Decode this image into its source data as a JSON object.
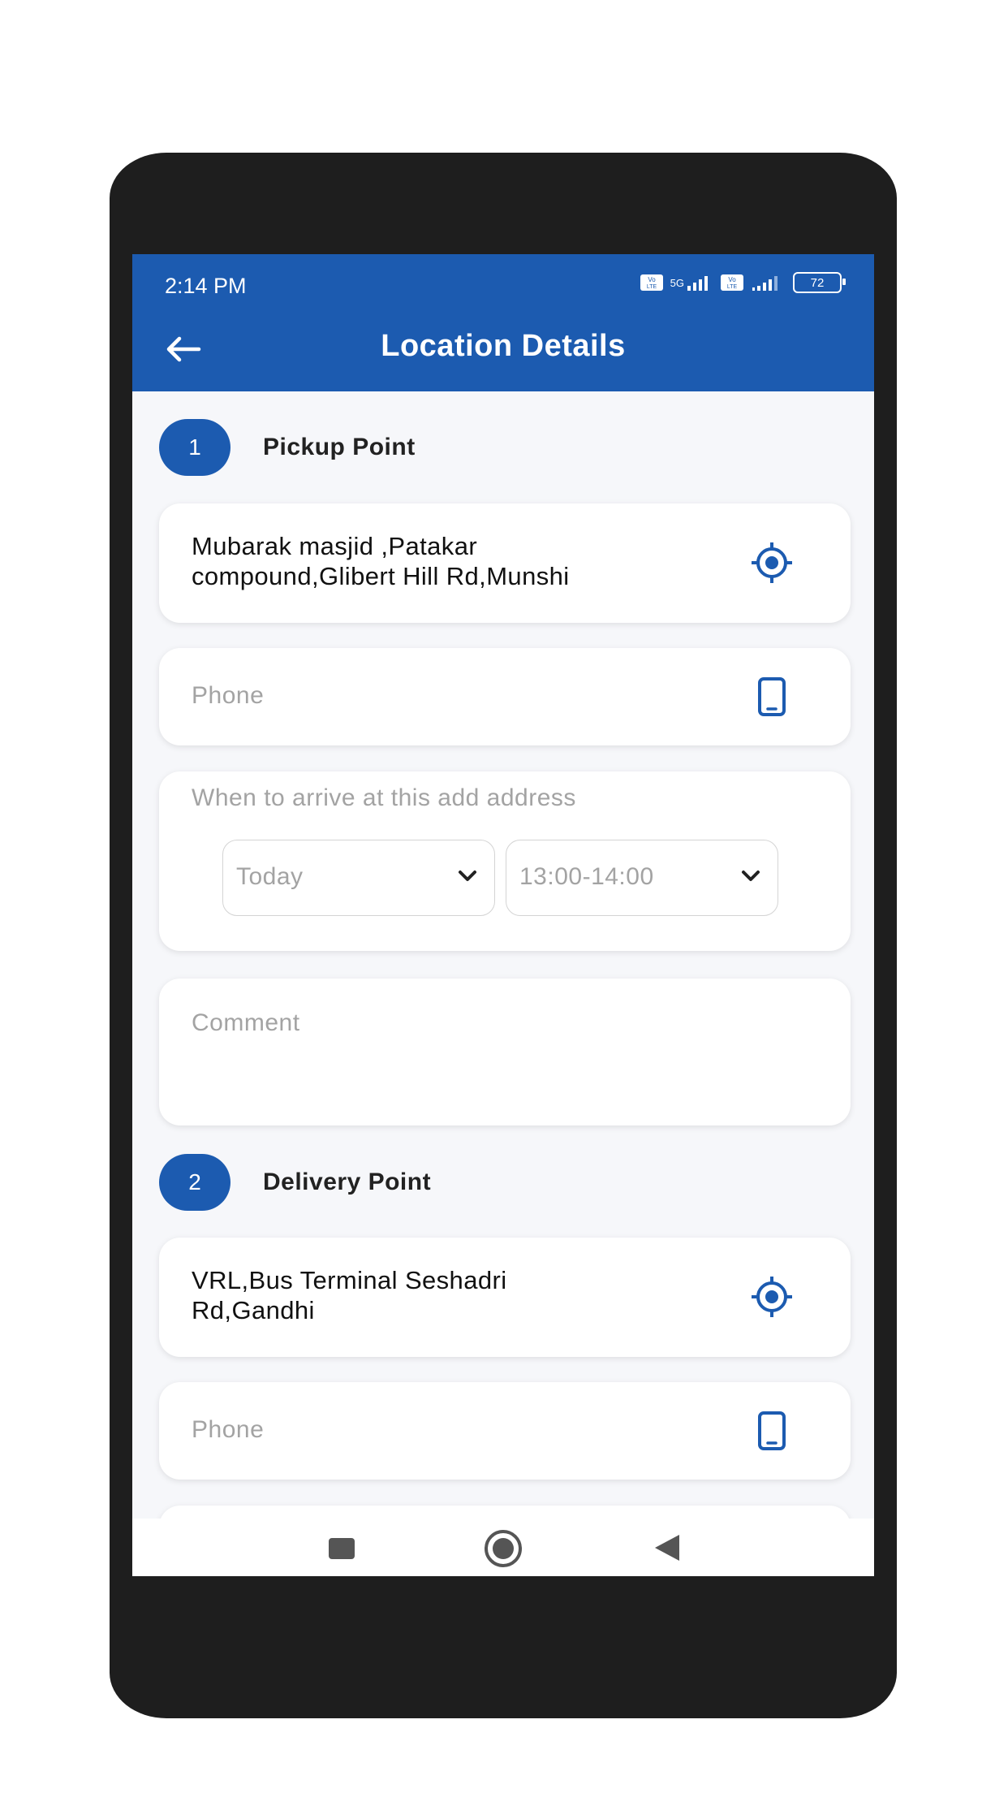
{
  "status_bar": {
    "time": "2:14 PM",
    "network_1": "5G",
    "battery": "72"
  },
  "app_bar": {
    "title": "Location Details",
    "back_icon": "arrow-left-icon"
  },
  "pickup": {
    "number": "1",
    "label": "Pickup Point",
    "address": "Mubarak masjid ,Patakar compound,Glibert Hill Rd,Munshi",
    "location_icon": "crosshair-icon",
    "phone_placeholder": "Phone",
    "phone_icon": "smartphone-icon",
    "arrive_label": "When to arrive at this add address",
    "day_value": "Today",
    "time_value": "13:00-14:00",
    "comment_placeholder": "Comment"
  },
  "delivery": {
    "number": "2",
    "label": "Delivery Point",
    "address": "VRL,Bus Terminal Seshadri Rd,Gandhi",
    "location_icon": "crosshair-icon",
    "phone_placeholder": "Phone",
    "phone_icon": "smartphone-icon"
  },
  "nav_bar": {
    "icons": [
      "recents-square-icon",
      "home-circle-icon",
      "back-triangle-icon"
    ]
  },
  "colors": {
    "primary": "#1c5bb0",
    "background": "#f6f7fa",
    "placeholder": "#a3a3a3",
    "device_frame": "#1e1e1e"
  }
}
